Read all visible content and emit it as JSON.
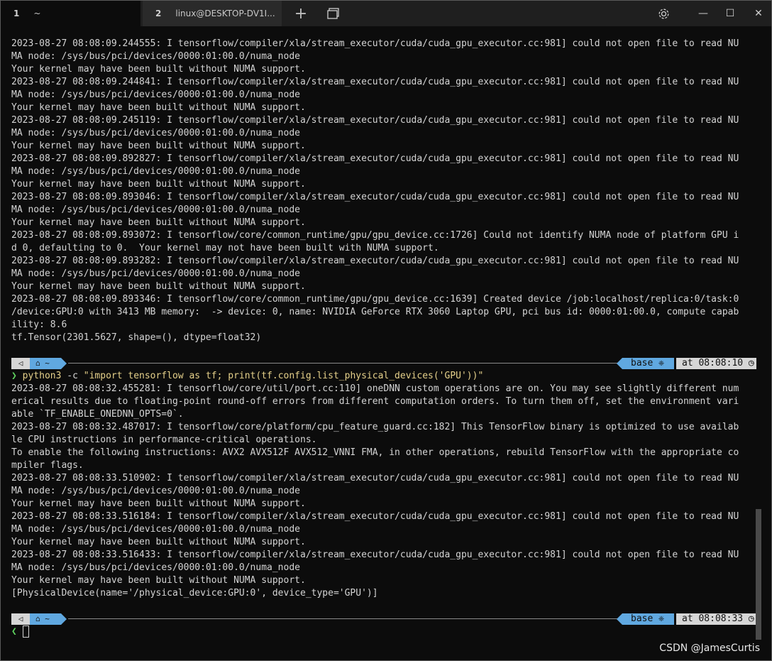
{
  "tabs": [
    {
      "number": "1",
      "title": "~"
    },
    {
      "number": "2",
      "title": "linux@DESKTOP-DV1I..."
    }
  ],
  "titlebar": {
    "new_tab": "+",
    "split_icon": "panes-icon",
    "settings_icon": "gear-icon",
    "minimize": "—",
    "maximize": "☐",
    "close": "✕"
  },
  "block1": [
    "2023-08-27 08:08:09.244555: I tensorflow/compiler/xla/stream_executor/cuda/cuda_gpu_executor.cc:981] could not open file to read NU",
    "MA node: /sys/bus/pci/devices/0000:01:00.0/numa_node",
    "Your kernel may have been built without NUMA support.",
    "2023-08-27 08:08:09.244841: I tensorflow/compiler/xla/stream_executor/cuda/cuda_gpu_executor.cc:981] could not open file to read NU",
    "MA node: /sys/bus/pci/devices/0000:01:00.0/numa_node",
    "Your kernel may have been built without NUMA support.",
    "2023-08-27 08:08:09.245119: I tensorflow/compiler/xla/stream_executor/cuda/cuda_gpu_executor.cc:981] could not open file to read NU",
    "MA node: /sys/bus/pci/devices/0000:01:00.0/numa_node",
    "Your kernel may have been built without NUMA support.",
    "2023-08-27 08:08:09.892827: I tensorflow/compiler/xla/stream_executor/cuda/cuda_gpu_executor.cc:981] could not open file to read NU",
    "MA node: /sys/bus/pci/devices/0000:01:00.0/numa_node",
    "Your kernel may have been built without NUMA support.",
    "2023-08-27 08:08:09.893046: I tensorflow/compiler/xla/stream_executor/cuda/cuda_gpu_executor.cc:981] could not open file to read NU",
    "MA node: /sys/bus/pci/devices/0000:01:00.0/numa_node",
    "Your kernel may have been built without NUMA support.",
    "2023-08-27 08:08:09.893072: I tensorflow/core/common_runtime/gpu/gpu_device.cc:1726] Could not identify NUMA node of platform GPU i",
    "d 0, defaulting to 0.  Your kernel may not have been built with NUMA support.",
    "2023-08-27 08:08:09.893282: I tensorflow/compiler/xla/stream_executor/cuda/cuda_gpu_executor.cc:981] could not open file to read NU",
    "MA node: /sys/bus/pci/devices/0000:01:00.0/numa_node",
    "Your kernel may have been built without NUMA support.",
    "2023-08-27 08:08:09.893346: I tensorflow/core/common_runtime/gpu/gpu_device.cc:1639] Created device /job:localhost/replica:0/task:0",
    "/device:GPU:0 with 3413 MB memory:  -> device: 0, name: NVIDIA GeForce RTX 3060 Laptop GPU, pci bus id: 0000:01:00.0, compute capab",
    "ility: 8.6",
    "tf.Tensor(2301.5627, shape=(), dtype=float32)"
  ],
  "prompt1": {
    "left1": "⌂",
    "left2": "⌂ ~",
    "env": "base ❈",
    "time": "at 08:08:10 ◷"
  },
  "command": {
    "arrow": "❯",
    "program": "python3",
    "flag": " -c ",
    "arg": "\"import tensorflow as tf; print(tf.config.list_physical_devices('GPU'))\""
  },
  "block2": [
    "2023-08-27 08:08:32.455281: I tensorflow/core/util/port.cc:110] oneDNN custom operations are on. You may see slightly different num",
    "erical results due to floating-point round-off errors from different computation orders. To turn them off, set the environment vari",
    "able `TF_ENABLE_ONEDNN_OPTS=0`.",
    "2023-08-27 08:08:32.487017: I tensorflow/core/platform/cpu_feature_guard.cc:182] This TensorFlow binary is optimized to use availab",
    "le CPU instructions in performance-critical operations.",
    "To enable the following instructions: AVX2 AVX512F AVX512_VNNI FMA, in other operations, rebuild TensorFlow with the appropriate co",
    "mpiler flags.",
    "2023-08-27 08:08:33.510902: I tensorflow/compiler/xla/stream_executor/cuda/cuda_gpu_executor.cc:981] could not open file to read NU",
    "MA node: /sys/bus/pci/devices/0000:01:00.0/numa_node",
    "Your kernel may have been built without NUMA support.",
    "2023-08-27 08:08:33.516184: I tensorflow/compiler/xla/stream_executor/cuda/cuda_gpu_executor.cc:981] could not open file to read NU",
    "MA node: /sys/bus/pci/devices/0000:01:00.0/numa_node",
    "Your kernel may have been built without NUMA support.",
    "2023-08-27 08:08:33.516433: I tensorflow/compiler/xla/stream_executor/cuda/cuda_gpu_executor.cc:981] could not open file to read NU",
    "MA node: /sys/bus/pci/devices/0000:01:00.0/numa_node",
    "Your kernel may have been built without NUMA support.",
    "[PhysicalDevice(name='/physical_device:GPU:0', device_type='GPU')]"
  ],
  "prompt2": {
    "left1": "⌂",
    "left2": "⌂ ~",
    "env": "base ❈",
    "time": "at 08:08:33 ◷"
  },
  "final_prompt": {
    "arrow": "❮"
  },
  "watermark": "CSDN @JamesCurtis"
}
